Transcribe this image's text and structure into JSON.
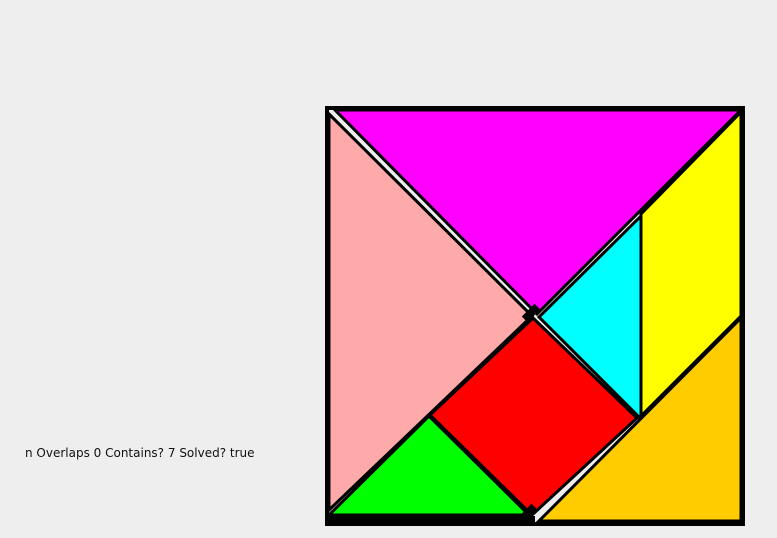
{
  "status": {
    "text": "n Overlaps 0 Contains? 7 Solved? true"
  },
  "puzzle": {
    "background_color": "#eeeeee",
    "outline_color": "#000000",
    "pieces": [
      {
        "name": "large-triangle-magenta",
        "color": "#ff00ff"
      },
      {
        "name": "large-triangle-pink",
        "color": "#ffaaaa"
      },
      {
        "name": "parallelogram-yellow",
        "color": "#ffff00"
      },
      {
        "name": "small-triangle-cyan",
        "color": "#00ffff"
      },
      {
        "name": "square-red",
        "color": "#ff0000"
      },
      {
        "name": "small-triangle-green",
        "color": "#00ff00"
      },
      {
        "name": "medium-triangle-orange",
        "color": "#ffcc00"
      }
    ]
  }
}
